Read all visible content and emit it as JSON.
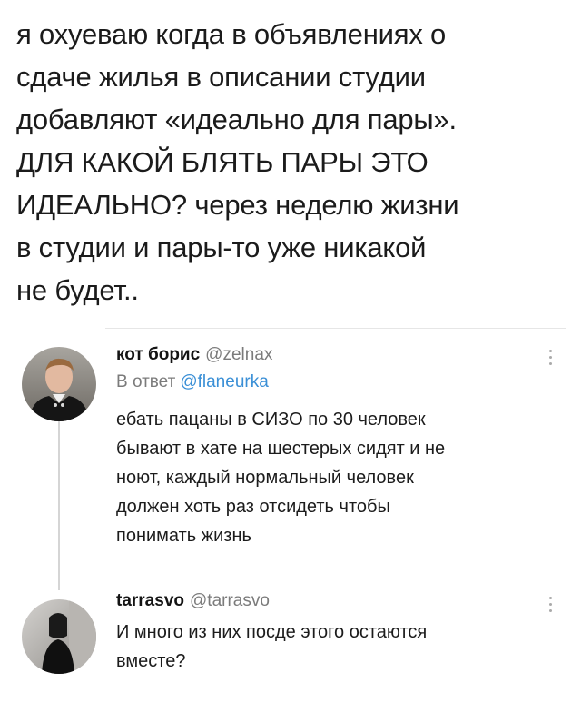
{
  "main_tweet": {
    "lines": [
      "я охуеваю когда в объявлениях о",
      "сдаче жилья в описании студии",
      "добавляют «идеально для пары».",
      "ДЛЯ КАКОЙ БЛЯТЬ ПАРЫ ЭТО",
      "ИДЕАЛЬНО? через неделю жизни",
      "в студии и пары-то уже никакой",
      "не будет.."
    ]
  },
  "replies": [
    {
      "display_name": "кот борис",
      "handle": "@zelnax",
      "in_reply_prefix": "В ответ",
      "in_reply_mention": "@flaneurka",
      "lines": [
        "ебать пацаны в СИЗО по 30 человек",
        "бывают в хате на шестерых сидят и не",
        "ноют, каждый нормальный человек",
        "должен хоть раз отсидеть чтобы",
        "понимать жизнь"
      ]
    },
    {
      "display_name": "tarrasvo",
      "handle": "@tarrasvo",
      "lines": [
        "И много из них посде этого остаются",
        "вместе?"
      ]
    }
  ],
  "icons": {
    "more": "more-vertical-icon"
  },
  "colors": {
    "text": "#1b1b1b",
    "secondary": "#7b7b7b",
    "link": "#3a8fd6",
    "divider": "#e6e6e6",
    "thread_line": "#d5d5d5"
  }
}
